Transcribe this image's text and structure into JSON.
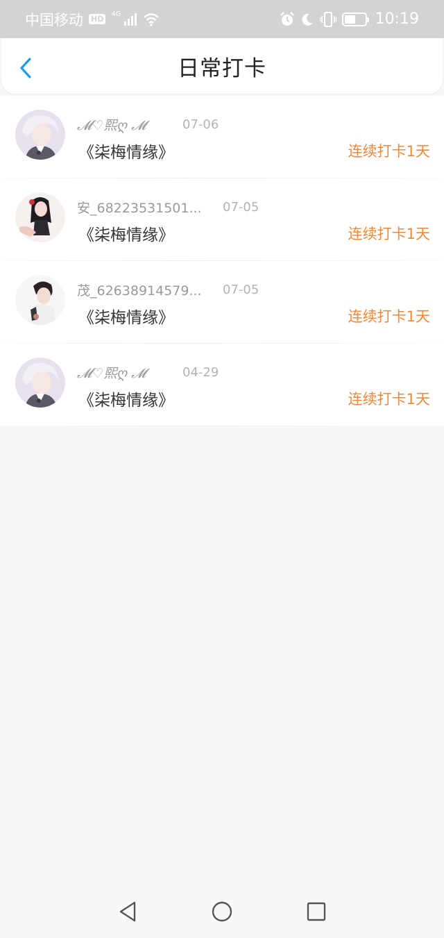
{
  "status_bar": {
    "carrier": "中国移动",
    "hd": "HD",
    "network": "4G",
    "time": "10:19",
    "battery_level": 0.55
  },
  "header": {
    "title": "日常打卡"
  },
  "items": [
    {
      "username": "𝓜♡熙ღ 𝓜",
      "date": "07-06",
      "book": "《柒梅情缘》",
      "streak": "连续打卡1天",
      "avatar": "avatar-white-hair"
    },
    {
      "username": "安_68223531501...",
      "date": "07-05",
      "book": "《柒梅情缘》",
      "streak": "连续打卡1天",
      "avatar": "avatar-dark-hair-girl"
    },
    {
      "username": "茂_62638914579...",
      "date": "07-05",
      "book": "《柒梅情缘》",
      "streak": "连续打卡1天",
      "avatar": "avatar-dark-hair-boy"
    },
    {
      "username": "𝓜♡熙ღ 𝓜",
      "date": "04-29",
      "book": "《柒梅情缘》",
      "streak": "连续打卡1天",
      "avatar": "avatar-white-hair"
    }
  ],
  "colors": {
    "accent_blue": "#1e9be8",
    "streak_orange": "#f0893a",
    "background": "#f8f6f7"
  }
}
